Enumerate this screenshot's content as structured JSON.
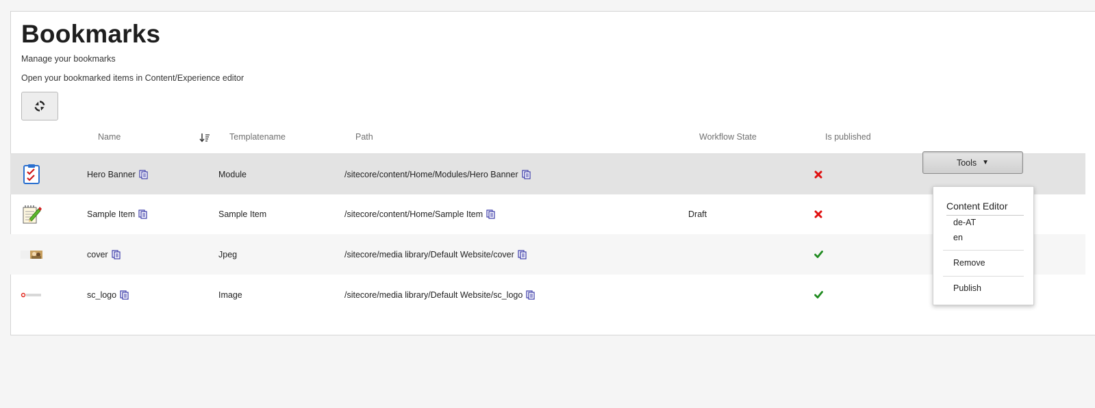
{
  "header": {
    "title": "Bookmarks",
    "subtitle": "Manage your bookmarks",
    "description": "Open your bookmarked items in Content/Experience editor"
  },
  "toolbar": {
    "refresh_icon": "refresh-icon"
  },
  "table": {
    "columns": [
      "Name",
      "Templatename",
      "Path",
      "Workflow State",
      "Is published"
    ],
    "sort_icon": "sort-descending-icon",
    "rows": [
      {
        "icon": "checklist-icon",
        "name": "Hero Banner",
        "template": "Module",
        "path": "/sitecore/content/Home/Modules/Hero Banner",
        "workflow": "",
        "published": false
      },
      {
        "icon": "notepad-pencil-icon",
        "name": "Sample Item",
        "template": "Sample Item",
        "path": "/sitecore/content/Home/Sample Item",
        "workflow": "Draft",
        "published": false
      },
      {
        "icon": "image-thumbnail-icon",
        "name": "cover",
        "template": "Jpeg",
        "path": "/sitecore/media library/Default Website/cover",
        "workflow": "",
        "published": true
      },
      {
        "icon": "sitecore-logo-thumbnail",
        "name": "sc_logo",
        "template": "Image",
        "path": "/sitecore/media library/Default Website/sc_logo",
        "workflow": "",
        "published": true
      }
    ]
  },
  "tools": {
    "label": "Tools",
    "menu": {
      "heading": "Content Editor",
      "languages": [
        "de-AT",
        "en"
      ],
      "remove": "Remove",
      "publish": "Publish"
    }
  },
  "colors": {
    "published_yes": "#1e8a1e",
    "published_no": "#e01010",
    "copy_icon": "#3a3aa8"
  }
}
